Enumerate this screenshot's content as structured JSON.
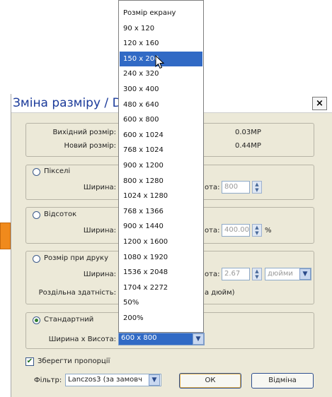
{
  "dialog": {
    "title": "Зміна разміру / D",
    "close_glyph": "×",
    "info": {
      "original_label": "Вихідний розмір:",
      "original_value": "0.03MP",
      "new_label": "Новий розмір:",
      "new_value": "0.44MP"
    },
    "pixels": {
      "radio_label": "Пікселі",
      "width_label": "Ширина:",
      "height_label": "ота:",
      "height_value": "800"
    },
    "percent": {
      "radio_label": "Відсоток",
      "width_label": "Ширина:",
      "height_label": "ота:",
      "height_value": "400.00",
      "unit": "%"
    },
    "print": {
      "radio_label": "Розмір при друку",
      "width_label": "Ширина:",
      "height_label": "ота:",
      "height_value": "2.67",
      "unit_value": "дюйми",
      "resolution_label": "Роздільна здатність:",
      "resolution_suffix": "а дюйм)"
    },
    "standard": {
      "radio_label": "Стандартний",
      "size_label": "Ширина х Висота:",
      "selected": "600 x 800"
    },
    "keep_ratio_label": "Зберегти пропорції",
    "filter_label": "Фільтр:",
    "filter_value": "Lanczos3 (за замовч",
    "ok_label": "ОК",
    "cancel_label": "Відміна"
  },
  "dropdown": {
    "options": [
      "Розмір екрану",
      "90 x 120",
      "120 x 160",
      "150 x 200",
      "240 x 320",
      "300 x 400",
      "480 x 640",
      "600 x 800",
      "600 x 1024",
      "768 x 1024",
      "900 x 1200",
      "800 x 1280",
      "1024 x 1280",
      "768 x 1366",
      "900 x 1440",
      "1200 x 1600",
      "1080 x 1920",
      "1536 x 2048",
      "1704 x 2272",
      "50%",
      "200%"
    ],
    "highlighted_index": 3
  },
  "colors": {
    "selection": "#316ac5",
    "title_text": "#1a3a9a",
    "dialog_bg": "#ece9d8",
    "marker": "#f08a1c"
  }
}
